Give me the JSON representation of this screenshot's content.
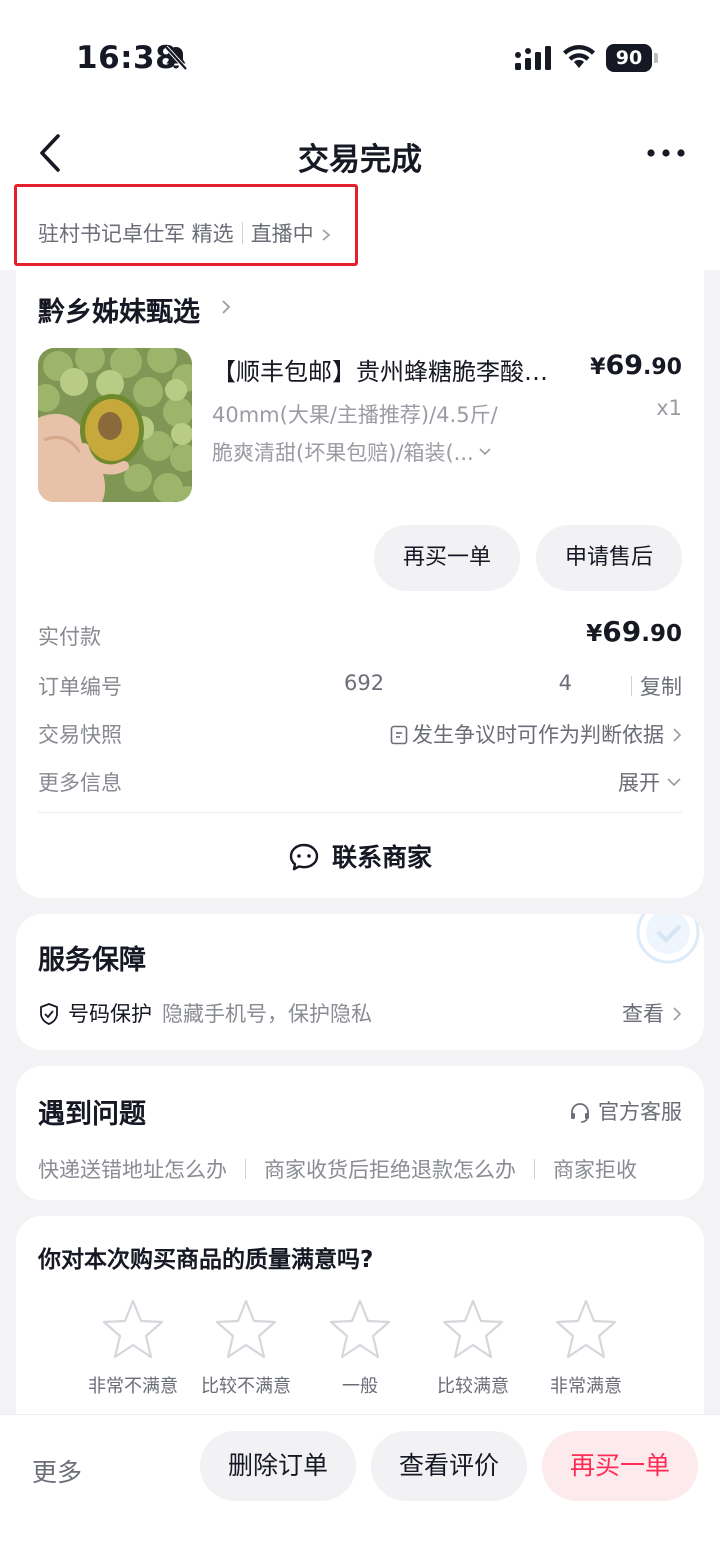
{
  "status_bar": {
    "time": "16:38",
    "battery": "90"
  },
  "nav": {
    "title": "交易完成"
  },
  "source": {
    "streamer": "驻村书记卓仕军 精选",
    "live": "直播中"
  },
  "shop": {
    "name": "黔乡姊妹甄选"
  },
  "product": {
    "title": "【顺丰包邮】贵州蜂糖脆李酸…",
    "price_symbol": "¥",
    "price_int": "69",
    "price_dec": ".90",
    "spec_line1": "40mm(大果/主播推荐)/4.5斤/",
    "spec_line2": "脆爽清甜(坏果包赔)/箱装(...",
    "quantity": "x1"
  },
  "actions": {
    "rebuy": "再买一单",
    "after_sale": "申请售后"
  },
  "details": {
    "paid_label": "实付款",
    "paid_symbol": "¥",
    "paid_int": "69",
    "paid_dec": ".90",
    "order_label": "订单编号",
    "order_prefix": "692",
    "order_suffix": "4",
    "copy": "复制",
    "snapshot_label": "交易快照",
    "snapshot_value": "发生争议时可作为判断依据",
    "more_label": "更多信息",
    "more_value": "展开"
  },
  "contact": {
    "label": "联系商家"
  },
  "service": {
    "title": "服务保障",
    "name": "号码保护",
    "desc": "隐藏手机号，保护隐私",
    "view": "查看"
  },
  "problems": {
    "title": "遇到问题",
    "cs": "官方客服",
    "faqs": [
      "快递送错地址怎么办",
      "商家收货后拒绝退款怎么办",
      "商家拒收"
    ]
  },
  "rating": {
    "question": "你对本次购买商品的质量满意吗?",
    "options": [
      "非常不满意",
      "比较不满意",
      "一般",
      "比较满意",
      "非常满意"
    ]
  },
  "bottom": {
    "more": "更多",
    "delete": "删除订单",
    "review": "查看评价",
    "rebuy": "再买一单"
  },
  "colors": {
    "accent": "#fe2c55",
    "highlight_box": "#e41f2e",
    "background": "#f3f3f6"
  }
}
